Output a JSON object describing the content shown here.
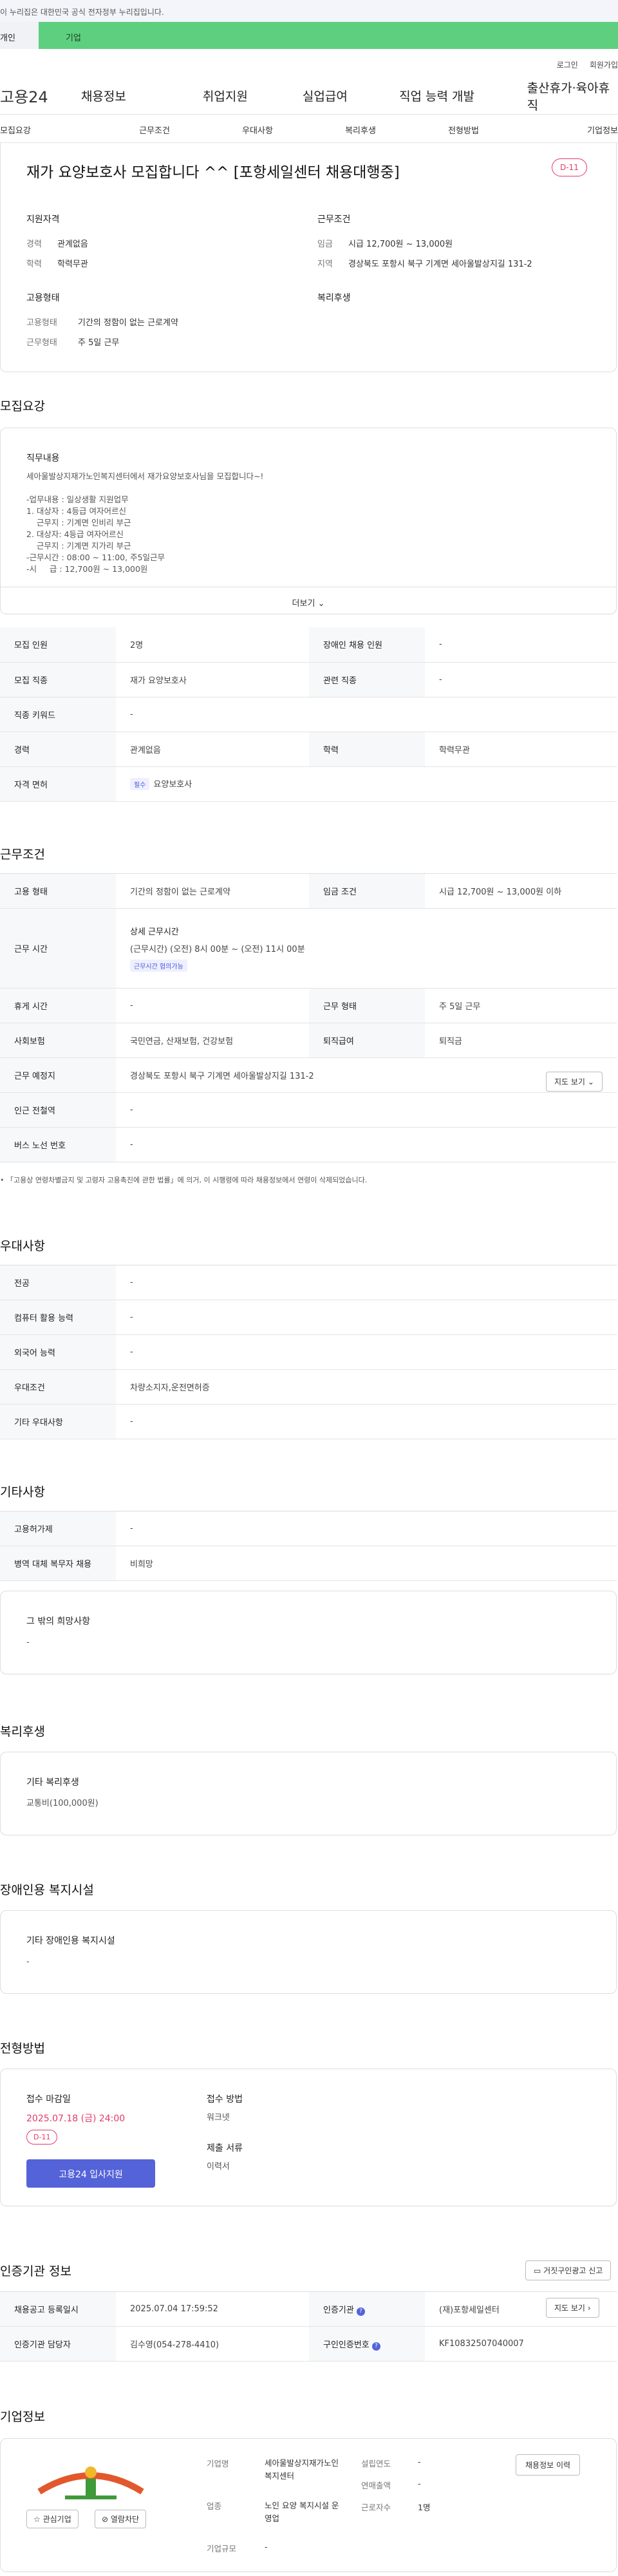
{
  "gov_bar": "이 누리집은 대한민국 공식 전자정부 누리집입니다.",
  "top_tabs": [
    "개인",
    "기업"
  ],
  "util": [
    "로그인",
    "회원가입"
  ],
  "logo": "고용24",
  "gnb": [
    "채용정보",
    "취업지원",
    "실업급여",
    "직업 능력 개발",
    "출산휴가·육아휴직"
  ],
  "lnb": [
    "모집요강",
    "근무조건",
    "우대사항",
    "복리후생",
    "전형방법",
    "기업정보"
  ],
  "summary": {
    "title": "재가 요양보호사 모집합니다 ^^ [포항세일센터 채용대행중]",
    "dday": "D-11",
    "qual_h": "지원자격",
    "career_k": "경력",
    "career_v": "관계없음",
    "edu_k": "학력",
    "edu_v": "학력무관",
    "cond_h": "근무조건",
    "wage_k": "임금",
    "wage_v": "시급 12,700원 ~ 13,000원",
    "area_k": "지역",
    "area_v": "경상북도 포항시 북구 기계면 세아울발상지길 131-2",
    "emp_h": "고용형태",
    "type_k": "고용형태",
    "type_v": "기간의 정함이 없는 근로계약",
    "worktype_k": "근무형태",
    "worktype_v": "주 5일 근무",
    "welfare_h": "복리후생"
  },
  "recruit": {
    "title": "모집요강",
    "duty_h": "직무내용",
    "duty_lines": [
      "세아울발상지재가노인복지센터에서 재가요양보호사님을 모집합니다~!",
      "",
      "-업무내용 : 일상생활 지원업무",
      "1. 대상자 : 4등급 여자어르신",
      "    근무지 : 기계면 인비리 부근",
      "2. 대상자: 4등급 여자어르신",
      "    근무지 : 기계면 지가리 부근",
      "-근무시간 : 08:00 ~ 11:00, 주5일근무",
      "-시     급 : 12,700원 ~ 13,000원"
    ],
    "more": "더보기",
    "rows": [
      [
        "모집 인원",
        "2명",
        "장애인 채용 인원",
        "-"
      ],
      [
        "모집 직종",
        "재가 요양보호사",
        "관련 직종",
        "-"
      ],
      [
        "직종 키워드",
        "-",
        "",
        ""
      ],
      [
        "경력",
        "관계없음",
        "학력",
        "학력무관"
      ]
    ],
    "license_k": "자격 면허",
    "license_badge": "필수",
    "license_v": "요양보호사"
  },
  "work": {
    "title": "근무조건",
    "emp_type_k": "고용 형태",
    "emp_type_v": "기간의 정함이 없는 근로계약",
    "wage_k": "임금 조건",
    "wage_v": "시급 12,700원 ~ 13,000원 이하",
    "hours_k": "근무 시간",
    "hours_h": "상세 근무시간",
    "hours_v": "(근무시간) (오전) 8시 00분 ~ (오전) 11시 00분",
    "hours_badge": "근무시간 협의가능",
    "rest_k": "휴게 시간",
    "rest_v": "-",
    "form_k": "근무 형태",
    "form_v": "주 5일 근무",
    "ins_k": "사회보험",
    "ins_v": "국민연금, 산재보험, 건강보험",
    "sev_k": "퇴직급여",
    "sev_v": "퇴직금",
    "place_k": "근무 예정지",
    "place_v": "경상북도 포항시 북구 기계면 세아울발상지길 131-2",
    "map_btn": "지도 보기",
    "station_k": "인근 전철역",
    "station_v": "-",
    "bus_k": "버스 노선 번호",
    "bus_v": "-",
    "note": "「고용상 연령차별금지 및 고령자 고용촉진에 관한 법률」에 의거, 이 시행령에 따라 채용정보에서 연령이 삭제되었습니다."
  },
  "pref": {
    "title": "우대사항",
    "rows": [
      [
        "전공",
        "-"
      ],
      [
        "컴퓨터 활용 능력",
        "-"
      ],
      [
        "외국어 능력",
        "-"
      ],
      [
        "우대조건",
        "차량소지자,운전면허증"
      ],
      [
        "기타 우대사항",
        "-"
      ]
    ]
  },
  "etc": {
    "title": "기타사항",
    "rows": [
      [
        "고용허가제",
        "-"
      ],
      [
        "병역 대체 복무자 채용",
        "비희망"
      ]
    ],
    "hope_h": "그 밖의 희망사항",
    "hope_v": "-"
  },
  "welfare": {
    "title": "복리후생",
    "h": "기타 복리후생",
    "v": "교통비(100,000원)"
  },
  "disabled": {
    "title": "장애인용 복지시설",
    "h": "기타 장애인용 복지시설",
    "v": "-"
  },
  "process": {
    "title": "전형방법",
    "deadline_h": "접수 마감일",
    "deadline_v": "2025.07.18 (금) 24:00",
    "dday": "D-11",
    "apply_btn": "고용24 입사지원",
    "method_h": "접수 방법",
    "method_v": "워크넷",
    "docs_h": "제출 서류",
    "docs_v": "이력서"
  },
  "agency": {
    "title": "인증기관 정보",
    "report_btn": "거짓구인광고 신고",
    "reg_k": "채용공고 등록일시",
    "reg_v": "2025.07.04 17:59:52",
    "cert_k": "인증기관",
    "cert_v": "(재)포항세일센터",
    "map_btn": "지도 보기",
    "mgr_k": "인증기관 담당자",
    "mgr_v": "김수영(054-278-4410)",
    "num_k": "구인인증번호",
    "num_v": "KF10832507040007"
  },
  "company": {
    "title": "기업정보",
    "fav_btn": "관심기업",
    "block_btn": "열람차단",
    "name_k": "기업명",
    "name_v": "세아울발상지재가노인복지센터",
    "year_k": "설립연도",
    "year_v": "-",
    "sales_k": "연매출액",
    "sales_v": "-",
    "biz_k": "업종",
    "biz_v": "노인 요양 복지시설 운영업",
    "staff_k": "근로자수",
    "staff_v": "1명",
    "scale_k": "기업규모",
    "scale_v": "-",
    "jobs_btn": "채용정보 이력"
  }
}
